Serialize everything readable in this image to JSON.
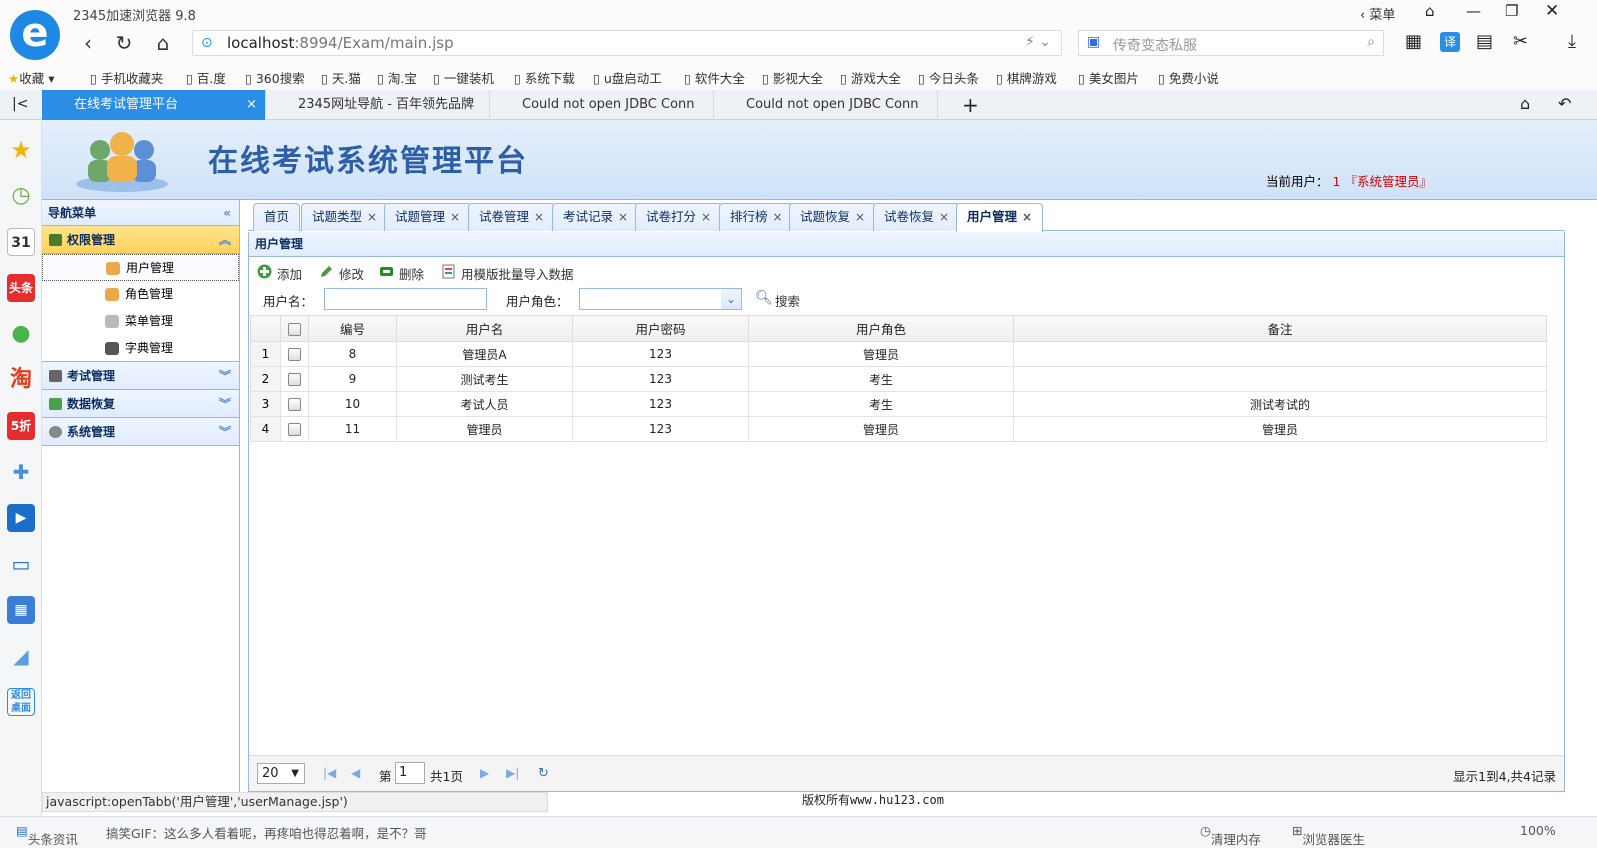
{
  "browser": {
    "name": "2345加速浏览器 9.8",
    "menu_label": "菜单",
    "address_host": "localhost",
    "address_path": ":8994/Exam/main.jsp",
    "search_placeholder": "传奇变态私服",
    "bookmarks": [
      "收藏",
      "手机收藏夹",
      "百.度",
      "360搜索",
      "天.猫",
      "淘.宝",
      "一键装机",
      "系统下载",
      "u盘启动工",
      "软件大全",
      "影视大全",
      "游戏大全",
      "今日头条",
      "棋牌游戏",
      "美女图片",
      "免费小说"
    ],
    "tabs": [
      "在线考试管理平台",
      "2345网址导航 - 百年领先品牌",
      "Could not open JDBC Conn",
      "Could not open JDBC Conn"
    ],
    "status_url": "javascript:openTabb('用户管理','userManage.jsp')",
    "bottom_news": [
      "头条资讯",
      "搞笑GIF：这么多人看着呢，再疼咱也得忍着啊，是不？哥"
    ],
    "bottom_right": [
      "清理内存",
      "浏览器医生",
      "100%"
    ],
    "sidebar_labels": [
      "31",
      "头条",
      "淘",
      "5折"
    ]
  },
  "header": {
    "title": "在线考试系统管理平台",
    "user_label": "当前用户：",
    "user_name": "1",
    "user_role": "『系统管理员』"
  },
  "nav": {
    "title": "导航菜单",
    "groups": [
      {
        "label": "权限管理",
        "items": [
          "用户管理",
          "角色管理",
          "菜单管理",
          "字典管理"
        ]
      },
      {
        "label": "考试管理"
      },
      {
        "label": "数据恢复"
      },
      {
        "label": "系统管理"
      }
    ]
  },
  "page_tabs": [
    "首页",
    "试题类型",
    "试题管理",
    "试卷管理",
    "考试记录",
    "试卷打分",
    "排行榜",
    "试题恢复",
    "试卷恢复",
    "用户管理"
  ],
  "panel": {
    "title": "用户管理",
    "toolbar": {
      "add": "添加",
      "edit": "修改",
      "delete": "删除",
      "import": "用模版批量导入数据"
    },
    "filter": {
      "username_label": "用户名：",
      "role_label": "用户角色：",
      "search": "搜索"
    }
  },
  "table": {
    "columns": [
      "编号",
      "用户名",
      "用户密码",
      "用户角色",
      "备注"
    ],
    "rows": [
      {
        "n": "1",
        "id": "8",
        "name": "管理员A",
        "pwd": "123",
        "role": "管理员",
        "note": ""
      },
      {
        "n": "2",
        "id": "9",
        "name": "测试考生",
        "pwd": "123",
        "role": "考生",
        "note": ""
      },
      {
        "n": "3",
        "id": "10",
        "name": "考试人员",
        "pwd": "123",
        "role": "考生",
        "note": "测试考试的"
      },
      {
        "n": "4",
        "id": "11",
        "name": "管理员",
        "pwd": "123",
        "role": "管理员",
        "note": "管理员"
      }
    ]
  },
  "pager": {
    "page_size": "20",
    "page_prefix": "第",
    "page_value": "1",
    "page_total": "共1页",
    "summary": "显示1到4,共4记录"
  },
  "footer": "版权所有www.hu123.com"
}
